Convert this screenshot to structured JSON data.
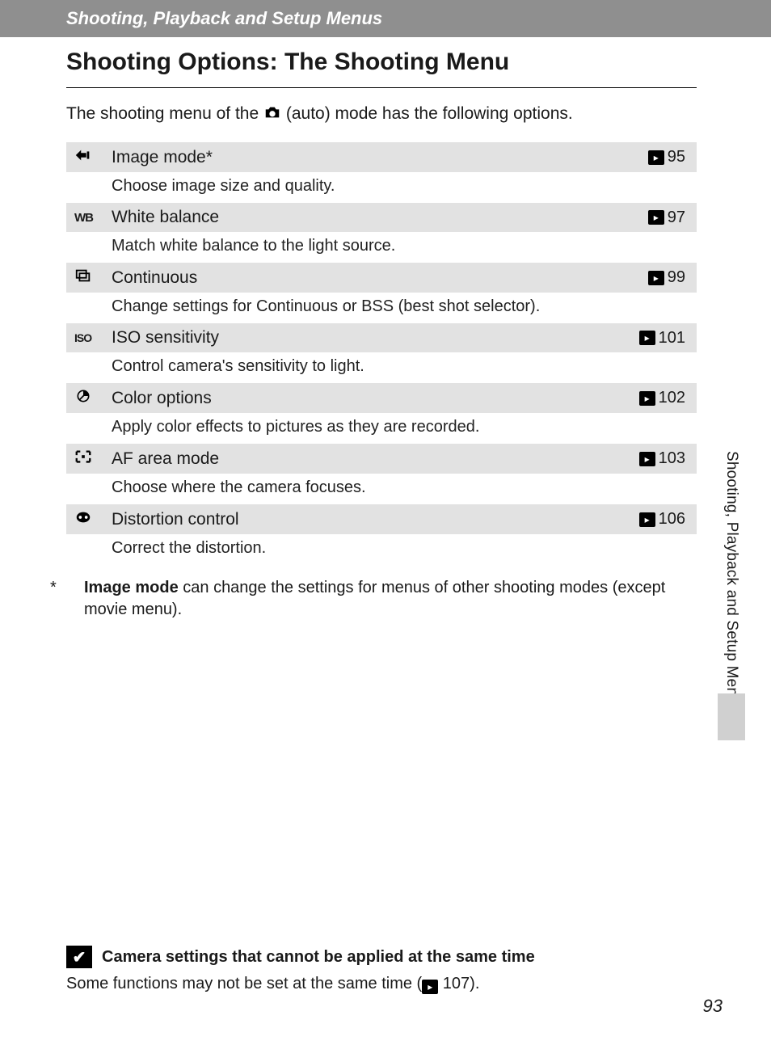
{
  "header": {
    "breadcrumb": "Shooting, Playback and Setup Menus",
    "title": "Shooting Options: The Shooting Menu"
  },
  "intro": {
    "before": "The shooting menu of the ",
    "after": " (auto) mode has the following options."
  },
  "options": [
    {
      "icon": "image-mode-icon",
      "label": "Image mode*",
      "page": "95",
      "desc": "Choose image size and quality."
    },
    {
      "icon": "wb-icon",
      "label": "White balance",
      "page": "97",
      "desc": "Match white balance to the light source."
    },
    {
      "icon": "continuous-icon",
      "label": "Continuous",
      "page": "99",
      "desc": "Change settings for Continuous or BSS (best shot selector)."
    },
    {
      "icon": "iso-icon",
      "label": "ISO sensitivity",
      "page": "101",
      "desc": "Control camera's sensitivity to light."
    },
    {
      "icon": "color-icon",
      "label": "Color options",
      "page": "102",
      "desc": "Apply color effects to pictures as they are recorded."
    },
    {
      "icon": "af-area-icon",
      "label": "AF area mode",
      "page": "103",
      "desc": "Choose where the camera focuses."
    },
    {
      "icon": "distortion-icon",
      "label": "Distortion control",
      "page": "106",
      "desc": "Correct the distortion."
    }
  ],
  "footnote": {
    "marker": "*",
    "bold": "Image mode",
    "rest": " can change the settings for menus of other shooting modes (except movie menu)."
  },
  "side_tab": "Shooting, Playback and Setup Menus",
  "bottom": {
    "title": "Camera settings that cannot be applied at the same time",
    "body_before": "Some functions may not be set at the same time (",
    "body_page": "107",
    "body_after": ")."
  },
  "page_number": "93",
  "glyphs": {
    "check": "✔"
  }
}
